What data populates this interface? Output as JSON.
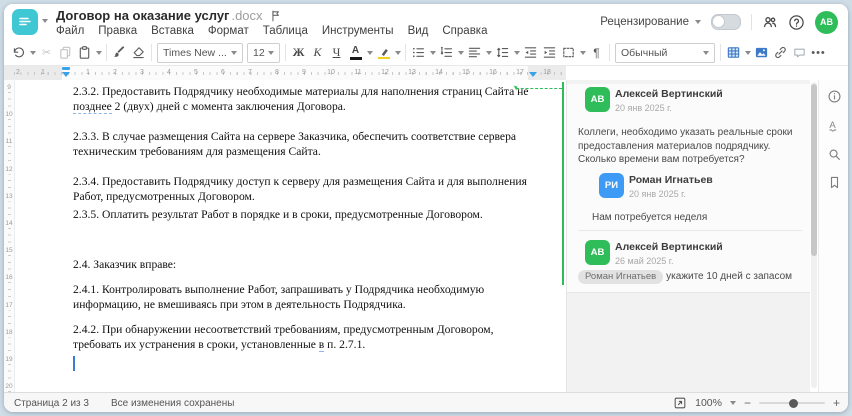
{
  "window": {
    "title": "Договор на оказание услуг",
    "title_ext": ".docx"
  },
  "menu": {
    "items": [
      "Файл",
      "Правка",
      "Вставка",
      "Формат",
      "Таблица",
      "Инструменты",
      "Вид",
      "Справка"
    ]
  },
  "header_right": {
    "review": "Рецензирование",
    "avatar": "АВ"
  },
  "toolbar": {
    "font": "Times New ...",
    "size": "12",
    "bold": "Ж",
    "italic": "К",
    "underline": "Ч",
    "style": "Обычный",
    "icons": {
      "cut": "✂",
      "pilcrow": "¶",
      "more": "•••",
      "fontcolor_letter": "А"
    }
  },
  "icons": {
    "spell_letter": "А"
  },
  "ruler": {
    "h_margin": [
      "2",
      "1"
    ],
    "h_main": [
      "1",
      "2",
      "3",
      "4",
      "5",
      "6",
      "7",
      "8",
      "9",
      "10",
      "11",
      "12",
      "13",
      "14",
      "15",
      "16",
      "17",
      "18"
    ],
    "v_main": [
      "9",
      "10",
      "11",
      "12",
      "13",
      "14",
      "15",
      "16",
      "17",
      "18",
      "19",
      "20"
    ]
  },
  "document": {
    "paragraphs": [
      {
        "pre": "2.3.2. Предоставить Подрядчику необходимые материалы для наполнения страниц Сайта не ",
        "marked": "позднее",
        "post": " 2 (двух) дней с момента заключения Договора."
      },
      {
        "text": "2.3.3. В случае размещения Сайта на сервере Заказчика, обеспечить соответствие сервера техническим требованиям для размещения Сайта."
      },
      {
        "text": "2.3.4. Предоставить Подрядчику доступ к серверу для размещения Сайта и для выполнения Работ, предусмотренных Договором."
      },
      {
        "text": "2.3.5. Оплатить результат Работ в порядке и в сроки, предусмотренные Договором."
      },
      {
        "text": "2.4. Заказчик вправе:"
      },
      {
        "text": "2.4.1. Контролировать выполнение Работ, запрашивать у Подрядчика необходимую информацию, не вмешиваясь при этом в деятельность Подрядчика."
      },
      {
        "pre": "2.4.2. При обнаружении несоответствий требованиям, предусмотренным Договором, требовать их устранения в сроки, установленные ",
        "marked": "в",
        "post": " п. 2.7.1."
      }
    ]
  },
  "comments": [
    {
      "initials": "АВ",
      "name": "Алексей Вертинский",
      "date": "20 янв 2025 г.",
      "text": "Коллеги, необходимо указать реальные сроки предоставления материалов подрядчику. Сколько времени вам потребуется?",
      "color": "#2ebd59"
    },
    {
      "initials": "РИ",
      "name": "Роман Игнатьев",
      "date": "20 янв 2025 г.",
      "text": "Нам потребуется неделя",
      "color": "#3d9bf5"
    },
    {
      "initials": "АВ",
      "name": "Алексей Вертинский",
      "date": "26 май 2025 г.",
      "mention": "Роман Игнатьев",
      "text": "укажите 10 дней с запасом",
      "color": "#2ebd59"
    }
  ],
  "status": {
    "page": "Страница 2 из 3",
    "saved": "Все изменения сохранены",
    "zoom": "100%",
    "zoom_out": "−",
    "zoom_in": "+"
  },
  "colors": {
    "teal": "#3fc7d4",
    "accent_blue": "#3e79c7",
    "green": "#2ebd59",
    "marker_blue": "#38a3e8"
  }
}
